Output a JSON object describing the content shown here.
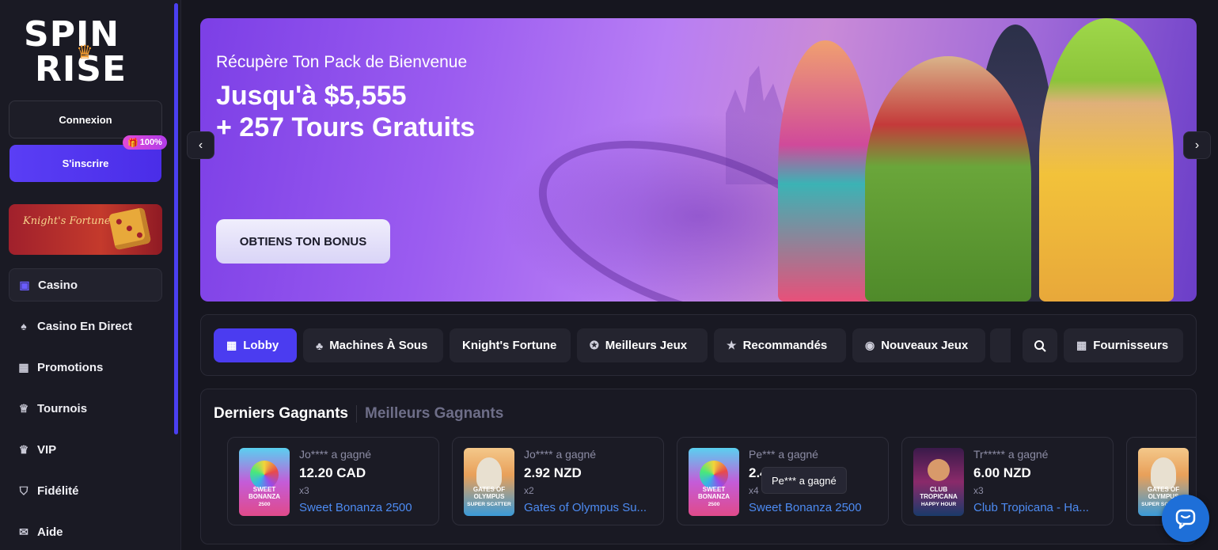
{
  "brand": {
    "line1": "SPIN",
    "line2": "RISE",
    "accent": "#f29a2e"
  },
  "sidebar": {
    "login_label": "Connexion",
    "signup_label": "S'inscrire",
    "signup_badge": "100%",
    "promo_logo": "Knight's Fortune",
    "items": [
      {
        "label": "Casino",
        "icon": "casino-icon"
      },
      {
        "label": "Casino En Direct",
        "icon": "spade-icon"
      },
      {
        "label": "Promotions",
        "icon": "gift-icon"
      },
      {
        "label": "Tournois",
        "icon": "trophy-icon"
      },
      {
        "label": "VIP",
        "icon": "crown-icon"
      },
      {
        "label": "Fidélité",
        "icon": "shield-icon"
      },
      {
        "label": "Aide",
        "icon": "chat-icon"
      }
    ]
  },
  "hero": {
    "subtitle": "Récupère Ton Pack de Bienvenue",
    "title_line1": "Jusqu'à $5,555",
    "title_line2": "+ 257 Tours Gratuits",
    "cta": "OBTIENS TON BONUS"
  },
  "tabs": {
    "items": [
      {
        "label": "Lobby",
        "icon": "grid-icon"
      },
      {
        "label": "Machines À Sous",
        "icon": "cherry-icon"
      },
      {
        "label": "Knight's Fortune",
        "icon": ""
      },
      {
        "label": "Meilleurs Jeux",
        "icon": "medal-icon"
      },
      {
        "label": "Recommandés",
        "icon": "star-icon"
      },
      {
        "label": "Nouveaux Jeux",
        "icon": "new-icon"
      }
    ],
    "providers_label": "Fournisseurs"
  },
  "winners": {
    "tab_latest": "Derniers Gagnants",
    "tab_best": "Meilleurs Gagnants",
    "cards": [
      {
        "who": "Jo**** a gagné",
        "amount": "12.20 CAD",
        "mult": "x3",
        "game": "Sweet Bonanza 2500",
        "thumb_title": "SWEET BONANZA",
        "thumb_sub": "2500"
      },
      {
        "who": "Jo**** a gagné",
        "amount": "2.92 NZD",
        "mult": "x2",
        "game": "Gates of Olympus Su...",
        "thumb_title": "GATES OF OLYMPUS",
        "thumb_sub": "SUPER SCATTER"
      },
      {
        "who": "Pe*** a gagné",
        "amount": "2.4",
        "mult": "x4",
        "game": "Sweet Bonanza 2500",
        "thumb_title": "SWEET BONANZA",
        "thumb_sub": "2500"
      },
      {
        "who": "Tr***** a gagné",
        "amount": "6.00 NZD",
        "mult": "x3",
        "game": "Club Tropicana - Ha...",
        "thumb_title": "CLUB TROPICANA",
        "thumb_sub": "HAPPY HOUR"
      },
      {
        "who": "",
        "amount": "",
        "mult": "",
        "game": "",
        "thumb_title": "GATES OF OLYMPUS",
        "thumb_sub": "SUPER SCATTER"
      }
    ],
    "tooltip": "Pe*** a gagné"
  }
}
